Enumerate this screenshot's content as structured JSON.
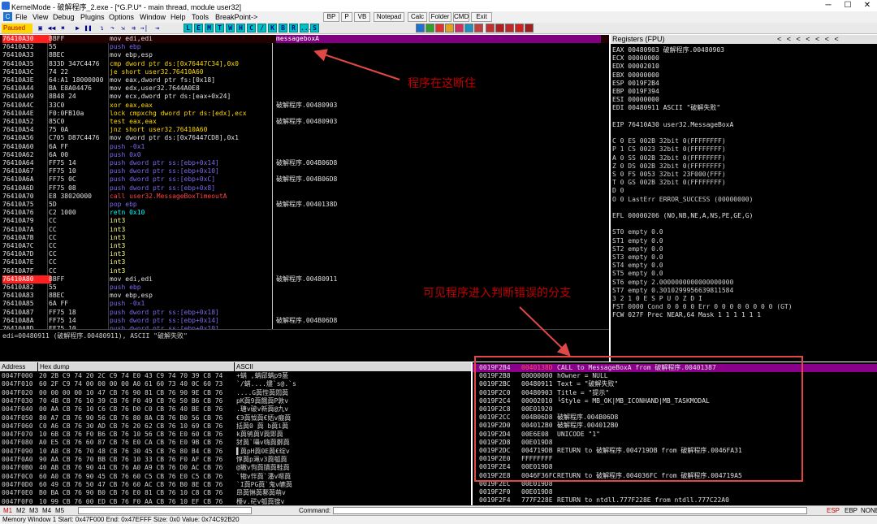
{
  "window": {
    "title": "KernelMode - 破解程序_2.exe - [*G.P.U* - main thread, module user32]",
    "minimize": "─",
    "maximize": "☐",
    "close": "✕"
  },
  "menu": {
    "items": [
      "File",
      "View",
      "Debug",
      "Plugins",
      "Options",
      "Window",
      "Help",
      "Tools",
      "BreakPoint->"
    ],
    "buttons": [
      "BP",
      "P",
      "VB",
      "Notepad",
      "Calc",
      "Folder",
      "CMD",
      "Exit"
    ]
  },
  "toolbar": {
    "status": "Paused",
    "letters": [
      "L",
      "E",
      "M",
      "T",
      "W",
      "H",
      "C",
      "/",
      "K",
      "B",
      "R",
      "...",
      "S"
    ]
  },
  "disasm": [
    {
      "a": "76410A30",
      "h": "8BFF",
      "d": "mov edi,edi",
      "c": "messageboxA",
      "hl": true
    },
    {
      "a": "76410A32",
      "h": "55",
      "d": "push ebp",
      "c": ""
    },
    {
      "a": "76410A33",
      "h": "8BEC",
      "d": "mov ebp,esp",
      "c": ""
    },
    {
      "a": "76410A35",
      "h": "833D 347C4476",
      "d": "cmp dword ptr ds:[0x76447C34],0x0",
      "c": ""
    },
    {
      "a": "76410A3C",
      "h": "74 22",
      "d": "je short user32.76410A60",
      "c": "",
      "j": true
    },
    {
      "a": "76410A3E",
      "h": "64:A1 18000000",
      "d": "mov eax,dword ptr fs:[0x18]",
      "c": ""
    },
    {
      "a": "76410A44",
      "h": "BA E8A04476",
      "d": "mov edx,user32.7644A0E8",
      "c": ""
    },
    {
      "a": "76410A49",
      "h": "8B48 24",
      "d": "mov ecx,dword ptr ds:[eax+0x24]",
      "c": ""
    },
    {
      "a": "76410A4C",
      "h": "33C0",
      "d": "xor eax,eax",
      "c": "破解程序.00480903"
    },
    {
      "a": "76410A4E",
      "h": "F0:0FB10a",
      "d": "lock cmpxchg dword ptr ds:[edx],ecx",
      "c": ""
    },
    {
      "a": "76410A52",
      "h": "85C0",
      "d": "test eax,eax",
      "c": "破解程序.00480903"
    },
    {
      "a": "76410A54",
      "h": "75 0A",
      "d": "jnz short user32.76410A60",
      "c": "",
      "j": true
    },
    {
      "a": "76410A56",
      "h": "C705 D87C4476",
      "d": "mov dword ptr ds:[0x76447CD8],0x1",
      "c": ""
    },
    {
      "a": "76410A60",
      "h": "6A FF",
      "d": "push -0x1",
      "c": ""
    },
    {
      "a": "76410A62",
      "h": "6A 00",
      "d": "push 0x0",
      "c": ""
    },
    {
      "a": "76410A64",
      "h": "FF75 14",
      "d": "push dword ptr ss:[ebp+0x14]",
      "c": "破解程序.004B06D8"
    },
    {
      "a": "76410A67",
      "h": "FF75 10",
      "d": "push dword ptr ss:[ebp+0x10]",
      "c": ""
    },
    {
      "a": "76410A6A",
      "h": "FF75 0C",
      "d": "push dword ptr ss:[ebp+0xC]",
      "c": "破解程序.004B06D8"
    },
    {
      "a": "76410A6D",
      "h": "FF75 08",
      "d": "push dword ptr ss:[ebp+0x8]",
      "c": ""
    },
    {
      "a": "76410A70",
      "h": "E8 38020000",
      "d": "call user32.MessageBoxTimeoutA",
      "c": "",
      "call": true
    },
    {
      "a": "76410A75",
      "h": "5D",
      "d": "pop ebp",
      "c": "破解程序.0040138D"
    },
    {
      "a": "76410A76",
      "h": "C2 1000",
      "d": "retn 0x10",
      "c": ""
    },
    {
      "a": "76410A79",
      "h": "CC",
      "d": "int3",
      "c": ""
    },
    {
      "a": "76410A7A",
      "h": "CC",
      "d": "int3",
      "c": ""
    },
    {
      "a": "76410A7B",
      "h": "CC",
      "d": "int3",
      "c": ""
    },
    {
      "a": "76410A7C",
      "h": "CC",
      "d": "int3",
      "c": ""
    },
    {
      "a": "76410A7D",
      "h": "CC",
      "d": "int3",
      "c": ""
    },
    {
      "a": "76410A7E",
      "h": "CC",
      "d": "int3",
      "c": ""
    },
    {
      "a": "76410A7F",
      "h": "CC",
      "d": "int3",
      "c": ""
    },
    {
      "a": "76410A80",
      "h": "8BFF",
      "d": "mov edi,edi",
      "c": "破解程序.00480911"
    },
    {
      "a": "76410A82",
      "h": "55",
      "d": "push ebp",
      "c": ""
    },
    {
      "a": "76410A83",
      "h": "8BEC",
      "d": "mov ebp,esp",
      "c": ""
    },
    {
      "a": "76410A85",
      "h": "6A FF",
      "d": "push -0x1",
      "c": ""
    },
    {
      "a": "76410A87",
      "h": "FF75 18",
      "d": "push dword ptr ss:[ebp+0x18]",
      "c": ""
    },
    {
      "a": "76410A8A",
      "h": "FF75 14",
      "d": "push dword ptr ss:[ebp+0x14]",
      "c": "破解程序.004B06D8"
    },
    {
      "a": "76410A8D",
      "h": "FF75 10",
      "d": "push dword ptr ss:[ebp+0x10]",
      "c": ""
    }
  ],
  "cpu_info": "edi=00480911 (破解程序.00480911), ASCII \"破解失败\"",
  "registers": {
    "header": "Registers (FPU)",
    "nav": "<  <  <  <  <  <  <",
    "lines": [
      "EAX 00480903 破解程序.00480903",
      "ECX 00000000",
      "EDX 00002010",
      "EBX 00000000",
      "ESP 0019F2B4",
      "EBP 0019F394",
      "ESI 00000000",
      "EDI 00480911 ASCII \"破解失败\"",
      "",
      "EIP 76410A30 user32.MessageBoxA",
      "",
      "C 0  ES 002B 32bit 0(FFFFFFFF)",
      "P 1  CS 0023 32bit 0(FFFFFFFF)",
      "A 0  SS 002B 32bit 0(FFFFFFFF)",
      "Z 0  DS 002B 32bit 0(FFFFFFFF)",
      "S 0  FS 0053 32bit 23F000(FFF)",
      "T 0  GS 002B 32bit 0(FFFFFFFF)",
      "D 0",
      "O 0  LastErr ERROR_SUCCESS (00000000)",
      "",
      "EFL 00000206 (NO,NB,NE,A,NS,PE,GE,G)",
      "",
      "ST0 empty 0.0",
      "ST1 empty 0.0",
      "ST2 empty 0.0",
      "ST3 empty 0.0",
      "ST4 empty 0.0",
      "ST5 empty 0.0",
      "ST6 empty 2.0000000000000000000",
      "ST7 empty 0.3010299956639811584",
      "               3 2 1 0      E S P U O Z D I",
      "FST 0000  Cond 0 0 0 0  Err 0 0 0 0 0 0 0 0  (GT)",
      "FCW 027F  Prec NEAR,64  Mask    1 1 1 1 1 1"
    ]
  },
  "dump": {
    "headers": [
      "Address",
      "Hex dump",
      "ASCII"
    ],
    "rows": [
      [
        "0047F000",
        "20 2B C9 74 20 2C C9 74 E0 43 C9 74 70 39 C8 74",
        " +蜹 ,蜹郈蜹p9萾"
      ],
      [
        "0047F010",
        "60 2F C9 74 00 00 00 00 A0 61 60 73 40 0C 60 73",
        "`/蜹....燼`s@.`s"
      ],
      [
        "0047F020",
        "00 00 00 00 10 47 CB 76 90 81 CB 76 90 9E CB 76",
        "....G藇悂藇悶藇"
      ],
      [
        "0047F030",
        "70 4B CB 76 10 39 CB 76 F0 49 CB 76 50 B6 CB 76",
        "pK藇9藇餓藇P敦v"
      ],
      [
        "0047F040",
        "00 AA CB 76 10 C6 CB 76 D0 C0 CB 76 40 BE CB 76",
        ".瑭v破v新藇@九v"
      ],
      [
        "0047F050",
        "80 A7 CB 76 90 56 CB 76 80 8A CB 76 B0 56 CB 76",
        "€Э藇怴藇€娝v癡藇"
      ],
      [
        "0047F060",
        "C0 A6 CB 76 30 AD CB 76 20 62 CB 76 10 69 CB 76",
        "括藇0 藇 b藇i藇"
      ],
      [
        "0047F070",
        "10 6B CB 76 F0 B6 CB 76 10 56 CB 76 E0 60 CB 76",
        "k藇鸲藇V藇郹藇"
      ],
      [
        "0047F080",
        "A0 E5 CB 76 60 87 CB 76 E0 CA CB 76 E0 9B CB 76",
        "犲藇`囁v嗨藇鄾藇"
      ],
      [
        "0047F090",
        "10 A8 CB 76 70 48 CB 76 30 45 CB 76 80 B4 CB 76",
        "▌藇pH藇0E藇€绽v"
      ],
      [
        "0047F0A0",
        "90 AA CB 76 70 BB CB 76 10 33 CB 76 F0 AF CB 76",
        "惇藇p渑v3藇瓠藇"
      ],
      [
        "0047F0B0",
        "40 AB CB 76 90 44 CB 76 A0 A9 CB 76 D0 AC CB 76",
        "@獙v怐藇牘藇鞋藇"
      ],
      [
        "0047F0C0",
        "60 A0 CB 76 90 45 CB 76 60 C5 CB 76 E0 C5 CB 76",
        "`犓v怑藇`潘v嗯藇"
      ],
      [
        "0047F0D0",
        "60 49 CB 76 50 47 CB 76 60 AC CB 76 B0 8E CB 76",
        "`I藇PG藇`鬼v皫藇"
      ],
      [
        "0047F0E0",
        "B0 BA CB 76 90 B0 CB 76 E0 81 CB 76 10 C8 CB 76",
        "昂藇惏藇鄟藇萌v"
      ],
      [
        "0047F0F0",
        "10 99 CB 76 00 ED CB 76 F0 AA CB 76 10 EF CB 76",
        "檯v.硭v瓠藇锼v"
      ]
    ]
  },
  "stack": [
    {
      "a": "0019F2B4",
      "v": "0040138D",
      "c": "CALL to MessageBoxA from 破解程序.00401387",
      "sel": true
    },
    {
      "a": "0019F2B8",
      "v": "00000000",
      "c": " hOwner = NULL"
    },
    {
      "a": "0019F2BC",
      "v": "00480911",
      "c": " Text = \"破解失败\""
    },
    {
      "a": "0019F2C0",
      "v": "00480903",
      "c": " Title = \"提示\""
    },
    {
      "a": "0019F2C4",
      "v": "00002010",
      "c": "└Style = MB_OK|MB_ICONHAND|MB_TASKMODAL"
    },
    {
      "a": "0019F2C8",
      "v": "00E01920",
      "c": ""
    },
    {
      "a": "0019F2CC",
      "v": "004B06D8",
      "c": "破解程序.004B06D8"
    },
    {
      "a": "0019F2D0",
      "v": "004012B0",
      "c": "破解程序.004012B0"
    },
    {
      "a": "0019F2D4",
      "v": "00E6E08",
      "c": "UNICODE \"1\""
    },
    {
      "a": "0019F2D8",
      "v": "00E019D8",
      "c": ""
    },
    {
      "a": "0019F2DC",
      "v": "004719DB",
      "c": "RETURN to 破解程序.004719DB from 破解程序.0046FA31"
    },
    {
      "a": "0019F2E0",
      "v": "FFFFFFFF",
      "c": ""
    },
    {
      "a": "0019F2E4",
      "v": "00E019D8",
      "c": ""
    },
    {
      "a": "0019F2E8",
      "v": "0046F36FC",
      "c": "RETURN to 破解程序.004036FC from 破解程序.004719A5"
    },
    {
      "a": "0019F2EC",
      "v": "00E019D8",
      "c": ""
    },
    {
      "a": "0019F2F0",
      "v": "00E019D8",
      "c": ""
    },
    {
      "a": "0019F2F4",
      "v": "777F228E",
      "c": "RETURN to ntdll.777F228E from ntdll.777C22A0"
    }
  ],
  "cmdbar": {
    "tabs": [
      "M1",
      "M2",
      "M3",
      "M4",
      "M5"
    ],
    "label": "Command:",
    "right": [
      "ESP",
      "EBP",
      "NONE"
    ]
  },
  "status": "Memory Window 1  Start: 0x47F000  End: 0x47EFFF  Size: 0x0 Value: 0x74C92B20",
  "annotations": {
    "a1": "程序在这断住",
    "a2": "可见程序进入判断错误的分支"
  },
  "colors": {
    "addr_hl": "#ff3030",
    "mnemonic_push": "#6a5acd",
    "mnemonic_call": "#ff2020",
    "jump": "#ffd700",
    "annotation": "#c00000"
  }
}
